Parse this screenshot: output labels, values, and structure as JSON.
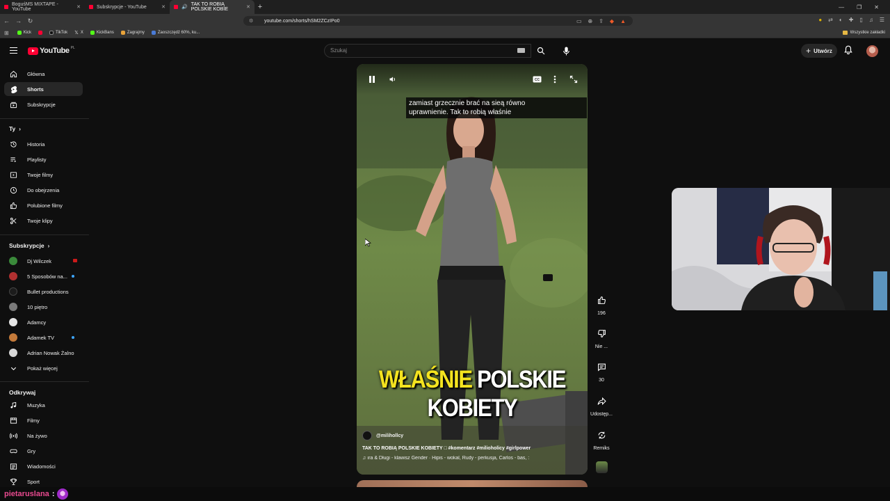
{
  "browser": {
    "tabs": [
      {
        "title": "BoguśMS MIXTAPE - YouTube",
        "active": false
      },
      {
        "title": "Subskrypcje - YouTube",
        "active": false
      },
      {
        "title": "TAK TO ROBIĄ POLSKIE KOBIE",
        "active": true
      }
    ],
    "url": "youtube.com/shorts/hSM2ZCzIPo0",
    "bookmarks": [
      "Kick",
      "TikTok",
      "X",
      "KickBans",
      "Zagrajmy",
      "Zaoszczędź 60%, ku..."
    ],
    "bookmarks_right": "Wszystkie zakładki"
  },
  "header": {
    "logo_text": "YouTube",
    "logo_country": "PL",
    "search_placeholder": "Szukaj",
    "create_label": "Utwórz"
  },
  "sidebar": {
    "main": [
      {
        "label": "Główna",
        "icon": "home-icon"
      },
      {
        "label": "Shorts",
        "icon": "shorts-icon",
        "active": true
      },
      {
        "label": "Subskrypcje",
        "icon": "subscriptions-icon"
      }
    ],
    "you_heading": "Ty",
    "you": [
      {
        "label": "Historia",
        "icon": "history-icon"
      },
      {
        "label": "Playlisty",
        "icon": "playlist-icon"
      },
      {
        "label": "Twoje filmy",
        "icon": "your-videos-icon"
      },
      {
        "label": "Do obejrzenia",
        "icon": "watch-later-icon"
      },
      {
        "label": "Polubione filmy",
        "icon": "liked-icon"
      },
      {
        "label": "Twoje klipy",
        "icon": "clips-icon"
      }
    ],
    "subs_heading": "Subskrypcje",
    "subs": [
      {
        "label": "Dj Wilczek",
        "color": "#3a8a3a",
        "badge": "live"
      },
      {
        "label": "5 Sposobów na...",
        "color": "#b03030",
        "badge": "new"
      },
      {
        "label": "Bullet productions",
        "color": "#1c1c1c"
      },
      {
        "label": "10 piętro",
        "color": "#7a7a7a"
      },
      {
        "label": "Adamcy",
        "color": "#e6e6e6"
      },
      {
        "label": "Adamek TV",
        "color": "#c47a3a",
        "badge": "new"
      },
      {
        "label": "Adrian Nowak Żalno",
        "color": "#d8d8d8"
      }
    ],
    "show_more": "Pokaż więcej",
    "explore_heading": "Odkrywaj",
    "explore": [
      {
        "label": "Muzyka",
        "icon": "music-icon"
      },
      {
        "label": "Filmy",
        "icon": "movies-icon"
      },
      {
        "label": "Na żywo",
        "icon": "live-icon"
      },
      {
        "label": "Gry",
        "icon": "gaming-icon"
      },
      {
        "label": "Wiadomości",
        "icon": "news-icon"
      },
      {
        "label": "Sport",
        "icon": "trophy-icon"
      }
    ]
  },
  "short": {
    "caption_line1": "zamiast grzecznie brać na sieą równo",
    "caption_line2": "uprawnienie. Tak to robią właśnie",
    "overlay_yellow": "WŁAŚNIE",
    "overlay_white": "POLSKIE KOBIETY",
    "channel": "@milihollcy",
    "description": "TAK TO ROBIĄ POLSKIE KOBIETY □ #komentarz #milioholicy #girlpower",
    "music": "ıra & Długi - klawisz    Gender · Hipis - wokal, Rudy - perkusja, Carlos - bas, :"
  },
  "actions": {
    "likes": "196",
    "dislike_label": "Nie ...",
    "comments": "30",
    "share_label": "Udostęp...",
    "remix_label": "Remiks"
  },
  "chat": {
    "username": "pietaruslana",
    "colon": ":"
  }
}
